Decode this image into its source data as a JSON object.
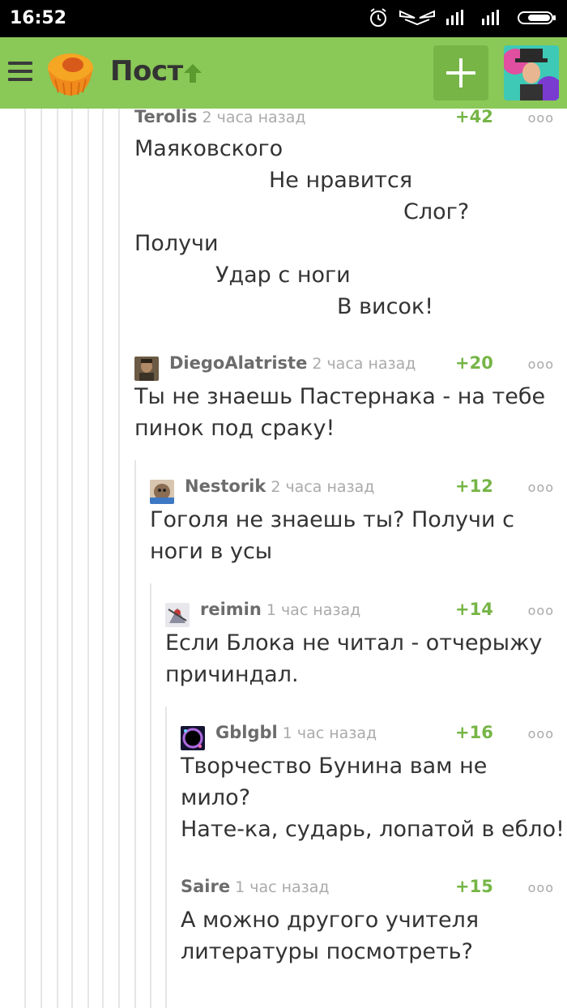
{
  "status_bar": {
    "time": "16:52"
  },
  "app_bar": {
    "title": "Пост"
  },
  "comments": [
    {
      "author": "Terolis",
      "time": "2 часа назад",
      "score": "+42",
      "lines": [
        "Маяковского",
        "Не нравится",
        "Слог?",
        "Получи",
        "Удар с ноги",
        "В висок!"
      ]
    },
    {
      "author": "DiegoAlatriste",
      "time": "2 часа назад",
      "score": "+20",
      "lines": [
        "Ты не знаешь Пастернака - на тебе",
        "пинок под сраку!"
      ]
    },
    {
      "author": "Nestorik",
      "time": "2 часа назад",
      "score": "+12",
      "lines": [
        "Гоголя не знаешь ты? Получи с",
        "ноги в усы"
      ]
    },
    {
      "author": "reimin",
      "time": "1 час назад",
      "score": "+14",
      "lines": [
        "Если Блока не читал - отчерыжу",
        "причиндал."
      ]
    },
    {
      "author": "Gblgbl",
      "time": "1 час назад",
      "score": "+16",
      "lines": [
        "Творчество Бунина вам не",
        "мило?",
        "Нате-ка, сударь, лопатой в ебло!"
      ]
    },
    {
      "author": "Saire",
      "time": "1 час назад",
      "score": "+15",
      "lines": [
        "А можно другого учителя",
        "литературы посмотреть?"
      ]
    }
  ],
  "more_glyph": "ooo"
}
